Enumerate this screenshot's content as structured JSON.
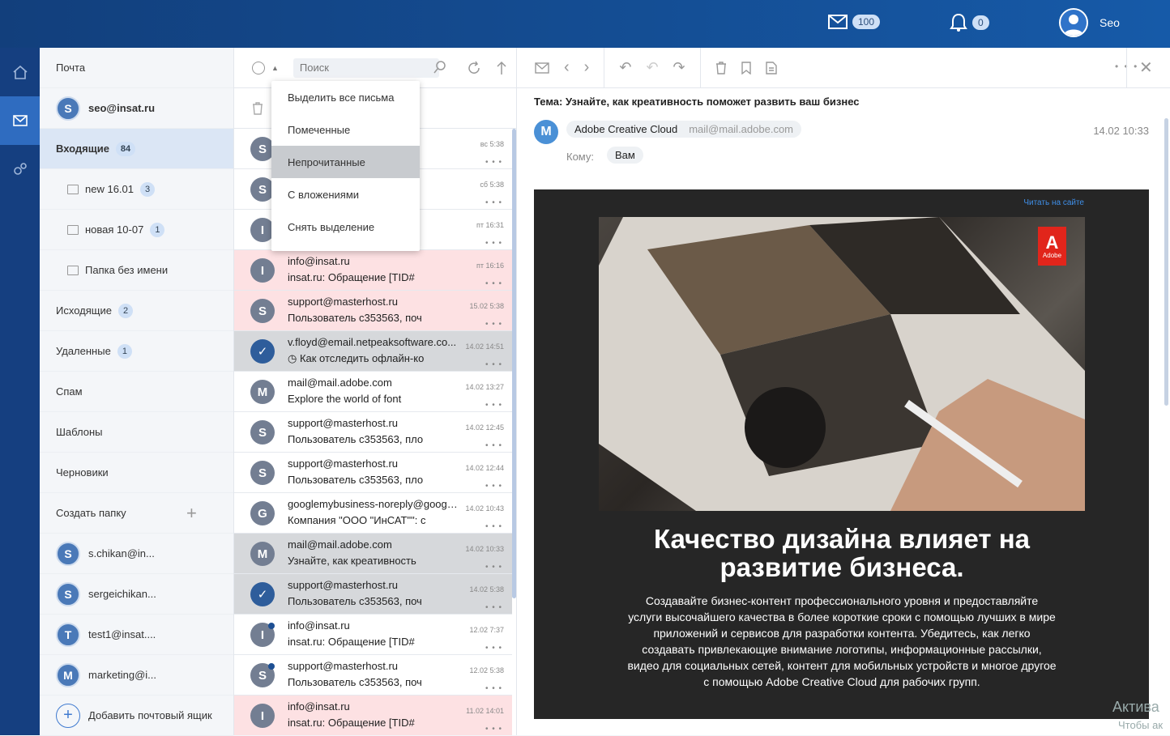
{
  "topbar": {
    "mail_count": "100",
    "notif_count": "0",
    "user_name": "Seo"
  },
  "folders": {
    "title": "Почта",
    "account": "seo@insat.ru",
    "inbox": {
      "label": "Входящие",
      "count": "84"
    },
    "subfolders": [
      {
        "label": "new 16.01",
        "count": "3"
      },
      {
        "label": "новая 10-07",
        "count": "1"
      },
      {
        "label": "Папка без имени",
        "count": ""
      }
    ],
    "outgoing": {
      "label": "Исходящие",
      "count": "2"
    },
    "deleted": {
      "label": "Удаленные",
      "count": "1"
    },
    "spam": "Спам",
    "templates": "Шаблоны",
    "drafts": "Черновики",
    "create_folder": "Создать папку",
    "accounts": [
      {
        "initial": "S",
        "email": "s.chikan@in..."
      },
      {
        "initial": "S",
        "email": "sergeichikan..."
      },
      {
        "initial": "T",
        "email": "test1@insat...."
      },
      {
        "initial": "M",
        "email": "marketing@i..."
      }
    ],
    "add_mailbox": "Добавить почтовый ящик"
  },
  "list": {
    "search_placeholder": "Поиск",
    "dropdown": [
      "Выделить все письма",
      "Помеченные",
      "Непрочитанные",
      "С вложениями",
      "Снять выделение"
    ],
    "messages": [
      {
        "initial": "S",
        "from": "",
        "subject": "",
        "date": "вс 5:38",
        "style": "white",
        "dots": "• • •"
      },
      {
        "initial": "S",
        "from": "",
        "subject": "",
        "date": "сб 5:38",
        "style": "white",
        "dots": "• • •"
      },
      {
        "initial": "I",
        "from": "",
        "subject": "",
        "date": "пт 16:31",
        "style": "white",
        "dots": "• • •"
      },
      {
        "initial": "I",
        "from": "info@insat.ru",
        "subject": "insat.ru: Обращение [TID#",
        "date": "пт 16:16",
        "style": "pink",
        "dots": "• • •"
      },
      {
        "initial": "S",
        "from": "support@masterhost.ru",
        "subject": "Пользователь c353563, поч",
        "date": "15.02 5:38",
        "style": "pink",
        "dots": "• • •"
      },
      {
        "initial": "✓",
        "from": "v.floyd@email.netpeaksoftware.co...",
        "subject": "◷ Как отследить офлайн-ко",
        "date": "14.02 14:51",
        "style": "grey",
        "dots": "• • •"
      },
      {
        "initial": "M",
        "from": "mail@mail.adobe.com",
        "subject": "Explore the world of font",
        "date": "14.02 13:27",
        "style": "white",
        "dots": "• • •"
      },
      {
        "initial": "S",
        "from": "support@masterhost.ru",
        "subject": "Пользователь c353563, пло",
        "date": "14.02 12:45",
        "style": "white",
        "dots": "• • •"
      },
      {
        "initial": "S",
        "from": "support@masterhost.ru",
        "subject": "Пользователь c353563, пло",
        "date": "14.02 12:44",
        "style": "white",
        "dots": "• • •"
      },
      {
        "initial": "G",
        "from": "googlemybusiness-noreply@googl...",
        "subject": "Компания \"ООО \"ИнСАТ\"\": с",
        "date": "14.02 10:43",
        "style": "white",
        "dots": "• • •"
      },
      {
        "initial": "M",
        "from": "mail@mail.adobe.com",
        "subject": "Узнайте, как креативность",
        "date": "14.02 10:33",
        "style": "grey",
        "dots": "• • •"
      },
      {
        "initial": "✓",
        "from": "support@masterhost.ru",
        "subject": "Пользователь c353563, поч",
        "date": "14.02 5:38",
        "style": "grey",
        "dots": "• • •"
      },
      {
        "initial": "I",
        "from": "info@insat.ru",
        "subject": "insat.ru: Обращение [TID#",
        "date": "12.02 7:37",
        "style": "white",
        "dots": "• • •"
      },
      {
        "initial": "S",
        "from": "support@masterhost.ru",
        "subject": "Пользователь c353563, поч",
        "date": "12.02 5:38",
        "style": "white",
        "dots": "• • •"
      },
      {
        "initial": "I",
        "from": "info@insat.ru",
        "subject": "insat.ru: Обращение [TID#",
        "date": "11.02 14:01",
        "style": "pink",
        "dots": "• • •"
      }
    ]
  },
  "reader": {
    "subject": "Тема: Узнайте, как креативность поможет развить ваш бизнес",
    "sender_initial": "M",
    "sender_name": "Adobe Creative Cloud",
    "sender_email": "mail@mail.adobe.com",
    "date": "14.02 10:33",
    "to_label": "Кому:",
    "to_value": "Вам",
    "read_online": "Читать на сайте",
    "adobe_text": "Adobe",
    "headline": "Качество дизайна влияет на развитие бизнеса.",
    "body": "Создавайте бизнес-контент профессионального уровня и предоставляйте услуги высочайшего качества в более короткие сроки с помощью лучших в мире приложений и сервисов для разработки контента. Убедитесь, как легко создавать привлекающие внимание логотипы, информационные рассылки, видео для социальных сетей, контент для мобильных устройств и многое другое с помощью Adobe Creative Cloud для рабочих групп.",
    "more_dots": "• • •"
  },
  "watermark": {
    "line1": "Актива",
    "line2": "Чтобы ак"
  },
  "colors": {
    "topbar": "#165aa8",
    "rail": "#153f80",
    "accent": "#2f6cc0",
    "unread_pink": "#fde1e3"
  }
}
